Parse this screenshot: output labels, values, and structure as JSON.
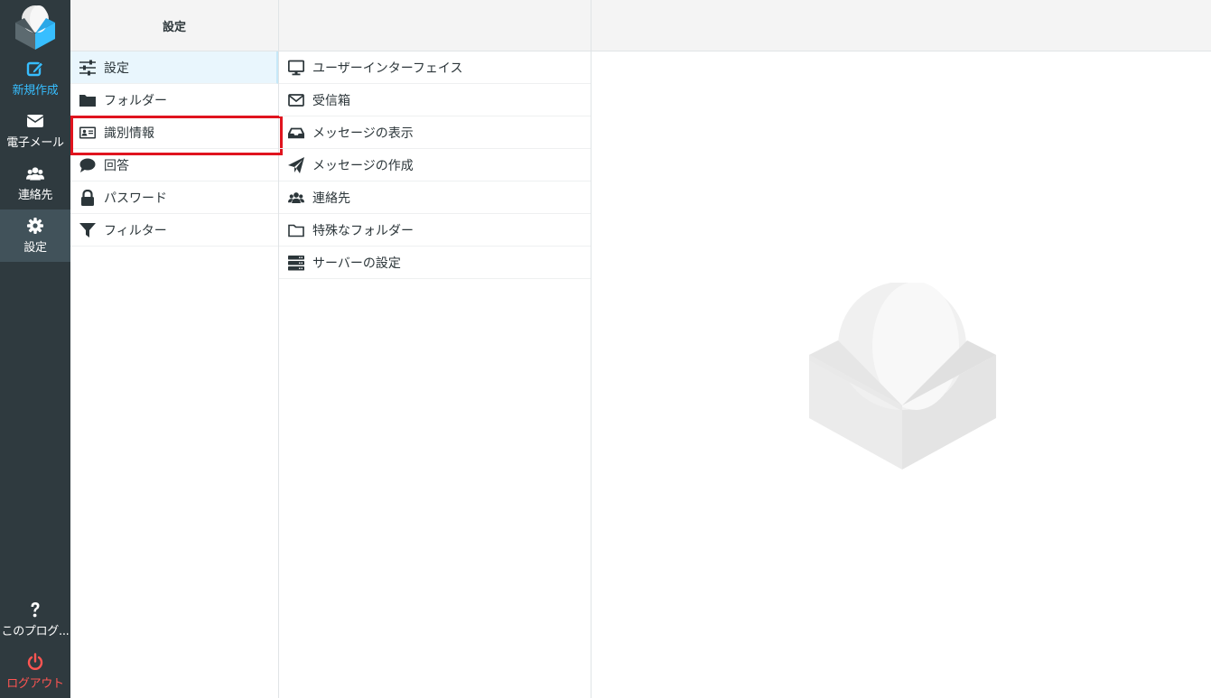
{
  "nav": {
    "items": [
      {
        "label": "新規作成",
        "icon": "compose-icon"
      },
      {
        "label": "電子メール",
        "icon": "envelope-icon"
      },
      {
        "label": "連絡先",
        "icon": "users-icon"
      },
      {
        "label": "設定",
        "icon": "gear-icon"
      }
    ],
    "bottom": [
      {
        "label": "このプログ...",
        "icon": "question-icon"
      },
      {
        "label": "ログアウト",
        "icon": "power-icon"
      }
    ]
  },
  "settings_column": {
    "title": "設定",
    "items": [
      {
        "label": "設定",
        "icon": "sliders-icon"
      },
      {
        "label": "フォルダー",
        "icon": "folder-icon"
      },
      {
        "label": "識別情報",
        "icon": "id-card-icon"
      },
      {
        "label": "回答",
        "icon": "speech-bubble-icon"
      },
      {
        "label": "パスワード",
        "icon": "lock-icon"
      },
      {
        "label": "フィルター",
        "icon": "filter-icon"
      }
    ]
  },
  "sections_column": {
    "title": "",
    "items": [
      {
        "label": "ユーザーインターフェイス",
        "icon": "monitor-icon"
      },
      {
        "label": "受信箱",
        "icon": "envelope-outline-icon"
      },
      {
        "label": "メッセージの表示",
        "icon": "inbox-tray-icon"
      },
      {
        "label": "メッセージの作成",
        "icon": "paper-plane-icon"
      },
      {
        "label": "連絡先",
        "icon": "users-icon"
      },
      {
        "label": "特殊なフォルダー",
        "icon": "folder-outline-icon"
      },
      {
        "label": "サーバーの設定",
        "icon": "server-icon"
      }
    ]
  },
  "colors": {
    "nav_bg": "#2f3a3f",
    "nav_selected": "#41525a",
    "compose_accent": "#37beff",
    "logout": "#ff5552",
    "highlight_box": "#e0141e",
    "active_row": "#e9f6fd"
  }
}
